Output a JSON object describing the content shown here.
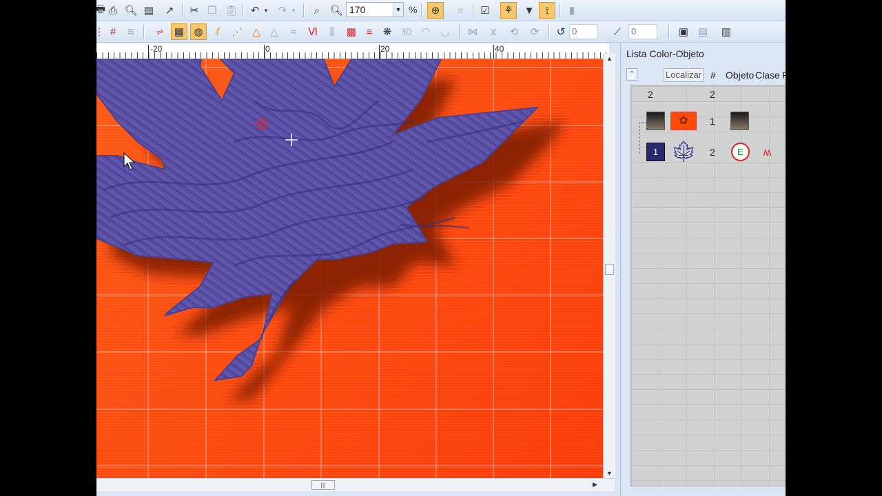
{
  "toolbar": {
    "zoom_value": "170",
    "zoom_unit": "%",
    "rotate_value": "0",
    "slant_value": "0",
    "effect_3d_label": "3D"
  },
  "ruler": {
    "labels": [
      "-20",
      "0",
      "20",
      "40"
    ]
  },
  "panel": {
    "title": "Lista Color-Objeto",
    "locate_button": "Localizar",
    "col_number": "#",
    "col_object": "Objeto",
    "col_class": "Clase",
    "col_p": "P",
    "summary_color_count": "2",
    "summary_object_count": "2",
    "rows": [
      {
        "number": "1",
        "icon": "person-thumbnail"
      },
      {
        "color_index": "1",
        "number": "2",
        "icon": "leaf-thumbnail"
      }
    ]
  },
  "colors": {
    "canvas_bg": "#ff4a0a",
    "leaf_fill": "#5a50a6",
    "leaf_stitch": "#3b3380",
    "grid_line": "#c9c9c9",
    "active_tool": "#f6c76d"
  }
}
